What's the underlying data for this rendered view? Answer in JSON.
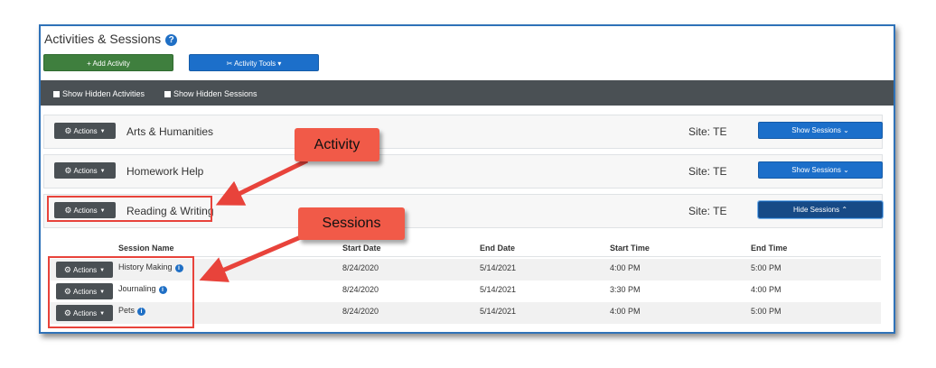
{
  "page": {
    "title": "Activities & Sessions"
  },
  "toolbar": {
    "add_activity_label": "+ Add Activity",
    "activity_tools_label": "✂ Activity Tools ▾"
  },
  "filters": {
    "show_hidden_activities": "Show Hidden Activities",
    "show_hidden_sessions": "Show Hidden Sessions"
  },
  "actions_label": "Actions",
  "activities": [
    {
      "name": "Arts & Humanities",
      "site": "Site: TE",
      "sessions_button": "Show Sessions ⌄"
    },
    {
      "name": "Homework Help",
      "site": "Site: TE",
      "sessions_button": "Show Sessions ⌄"
    },
    {
      "name": "Reading & Writing",
      "site": "Site: TE",
      "sessions_button": "Hide Sessions ⌃"
    }
  ],
  "sessions_table": {
    "headers": [
      "Session Name",
      "Start Date",
      "End Date",
      "Start Time",
      "End Time"
    ],
    "rows": [
      {
        "name": "History Making",
        "start_date": "8/24/2020",
        "end_date": "5/14/2021",
        "start_time": "4:00 PM",
        "end_time": "5:00 PM"
      },
      {
        "name": "Journaling",
        "start_date": "8/24/2020",
        "end_date": "5/14/2021",
        "start_time": "3:30 PM",
        "end_time": "4:00 PM"
      },
      {
        "name": "Pets",
        "start_date": "8/24/2020",
        "end_date": "5/14/2021",
        "start_time": "4:00 PM",
        "end_time": "5:00 PM"
      }
    ]
  },
  "annotations": {
    "activity_callout": "Activity",
    "sessions_callout": "Sessions"
  },
  "colors": {
    "accent_blue": "#1c6fca",
    "add_green": "#3f7f3e",
    "dark_bar": "#4a5054",
    "callout_red": "#f15a48"
  }
}
